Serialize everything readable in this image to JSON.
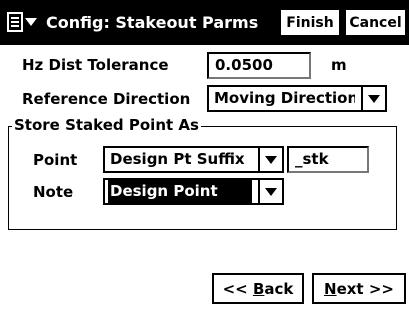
{
  "titlebar": {
    "title": "Config: Stakeout Parms",
    "finish_label": "Finish",
    "cancel_label": "Cancel",
    "menu_icon": "window-menu-icon"
  },
  "hz_dist": {
    "label": "Hz Dist Tolerance",
    "value": "0.0500",
    "unit": "m"
  },
  "reference": {
    "label": "Reference Direction",
    "value": "Moving Direction"
  },
  "store_group": {
    "title": "Store Staked Point As",
    "point": {
      "label": "Point",
      "value": "Design Pt Suffix",
      "suffix_value": "_stk"
    },
    "note": {
      "label": "Note",
      "value": "Design Point"
    }
  },
  "nav": {
    "back_prefix": "<< ",
    "back_accel": "B",
    "back_rest": "ack",
    "next_accel": "N",
    "next_rest": "ext >>"
  }
}
